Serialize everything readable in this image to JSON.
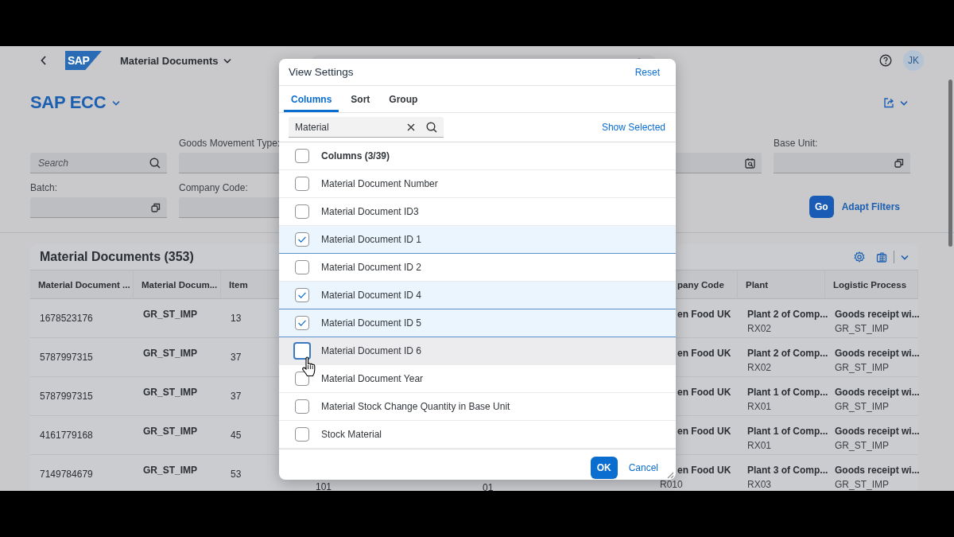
{
  "shell": {
    "logo": "SAP",
    "app_title": "Material Documents",
    "avatar": "JK"
  },
  "page": {
    "title": "SAP ECC"
  },
  "filter_bar": {
    "rows": [
      [
        {
          "kind": "search",
          "placeholder": "Search"
        },
        {
          "kind": "plain",
          "label": "Goods Movement Type:"
        },
        {
          "kind": "date"
        },
        {
          "kind": "value-help",
          "label": "Base Unit:"
        }
      ],
      [
        {
          "kind": "value-help",
          "label": "Batch:"
        },
        {
          "kind": "plain",
          "label": "Company Code:"
        }
      ]
    ],
    "go": "Go",
    "adapt_filters": "Adapt Filters"
  },
  "table": {
    "title": "Material Documents (353)",
    "columns": [
      "Material Document ...",
      "Material Docum...",
      "Item",
      "pany Code",
      "Plant",
      "Logistic Process"
    ],
    "rows": [
      {
        "material_document": "1678523176",
        "material_document_2": "GR_ST_IMP",
        "item": "13",
        "company_code": {
          "name": "en Food UK"
        },
        "plant": {
          "name": "Plant 2 of Comp...",
          "code": "RX02"
        },
        "logistic_process": {
          "name": "Goods receipt wi...",
          "code": "GR_ST_IMP"
        }
      },
      {
        "material_document": "5787997315",
        "material_document_2": "GR_ST_IMP",
        "item": "37",
        "company_code": {
          "name": "en Food UK"
        },
        "plant": {
          "name": "Plant 2 of Comp...",
          "code": "RX02"
        },
        "logistic_process": {
          "name": "Goods receipt wi...",
          "code": "GR_ST_IMP"
        }
      },
      {
        "material_document": "5787997315",
        "material_document_2": "GR_ST_IMP",
        "item": "37",
        "company_code": {
          "name": "en Food UK"
        },
        "plant": {
          "name": "Plant 1 of Comp...",
          "code": "RX01"
        },
        "logistic_process": {
          "name": "Goods receipt wi...",
          "code": "GR_ST_IMP"
        }
      },
      {
        "material_document": "4161779168",
        "material_document_2": "GR_ST_IMP",
        "item": "45",
        "company_code": {
          "name": "en Food UK"
        },
        "plant": {
          "name": "Plant 1 of Comp...",
          "code": "RX01"
        },
        "logistic_process": {
          "name": "Goods receipt wi...",
          "code": "GR_ST_IMP"
        }
      },
      {
        "material_document": "7149784679",
        "material_document_2": "GR_ST_IMP",
        "item": "53",
        "column_4": "101",
        "column_5": "01",
        "company_code": {
          "name": "en Food UK",
          "code": "R010"
        },
        "plant": {
          "name": "Plant 3 of Comp...",
          "code": "RX03"
        },
        "logistic_process": {
          "name": "Goods receipt wi...",
          "code": "GR_ST_IMP"
        }
      }
    ]
  },
  "dialog": {
    "title": "View Settings",
    "reset": "Reset",
    "tabs": [
      {
        "label": "Columns",
        "selected": true
      },
      {
        "label": "Sort",
        "selected": false
      },
      {
        "label": "Group",
        "selected": false
      }
    ],
    "search": {
      "value": "Material"
    },
    "show_selected": "Show Selected",
    "select_all": {
      "label": "Columns (3/39)",
      "checked": false
    },
    "items": [
      {
        "label": "Material Document Number",
        "checked": false,
        "hovered": false
      },
      {
        "label": "Material Document ID3",
        "checked": false,
        "hovered": false
      },
      {
        "label": "Material Document ID 1",
        "checked": true,
        "hovered": false
      },
      {
        "label": "Material Document ID 2",
        "checked": false,
        "hovered": false
      },
      {
        "label": "Material Document ID 4",
        "checked": true,
        "hovered": false
      },
      {
        "label": "Material Document ID 5",
        "checked": true,
        "hovered": false
      },
      {
        "label": "Material Document ID 6",
        "checked": false,
        "hovered": true
      },
      {
        "label": "Material Document Year",
        "checked": false,
        "hovered": false
      },
      {
        "label": "Material Stock Change Quantity in Base Unit",
        "checked": false,
        "hovered": false
      },
      {
        "label": "Stock Material",
        "checked": false,
        "hovered": false
      }
    ],
    "ok": "OK",
    "cancel": "Cancel"
  }
}
